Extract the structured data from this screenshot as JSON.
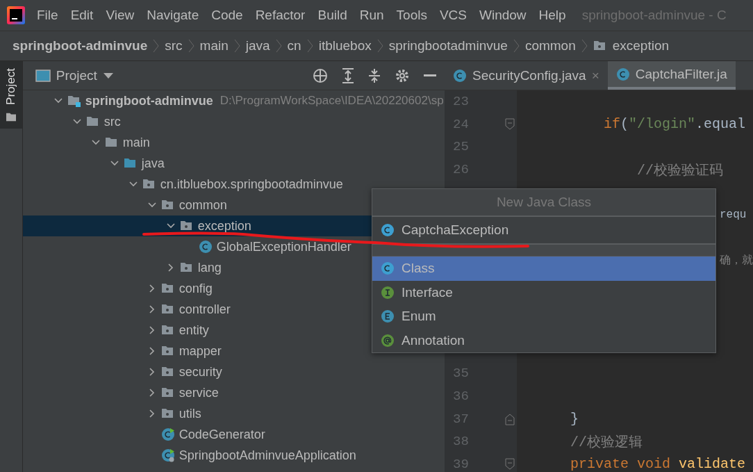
{
  "menu": {
    "items": [
      "File",
      "Edit",
      "View",
      "Navigate",
      "Code",
      "Refactor",
      "Build",
      "Run",
      "Tools",
      "VCS",
      "Window",
      "Help"
    ],
    "title": "springboot-adminvue - C"
  },
  "breadcrumbs": [
    {
      "label": "springboot-adminvue",
      "kind": "project"
    },
    {
      "label": "src",
      "kind": "plain"
    },
    {
      "label": "main",
      "kind": "plain"
    },
    {
      "label": "java",
      "kind": "plain"
    },
    {
      "label": "cn",
      "kind": "plain"
    },
    {
      "label": "itbluebox",
      "kind": "plain"
    },
    {
      "label": "springbootadminvue",
      "kind": "plain"
    },
    {
      "label": "common",
      "kind": "plain"
    },
    {
      "label": "exception",
      "kind": "folder"
    }
  ],
  "side_strip": {
    "label": "Project",
    "selected": true
  },
  "project_panel": {
    "title": "Project",
    "tree": [
      {
        "label": "springboot-adminvue",
        "path": "D:\\ProgramWorkSpace\\IDEA\\20220602\\sp",
        "kind": "module",
        "expanded": true,
        "selected": false,
        "children": [
          {
            "label": "src",
            "kind": "folder",
            "expanded": true,
            "selected": false,
            "children": [
              {
                "label": "main",
                "kind": "folder",
                "expanded": true,
                "selected": false,
                "children": [
                  {
                    "label": "java",
                    "kind": "source",
                    "expanded": true,
                    "selected": false,
                    "children": [
                      {
                        "label": "cn.itbluebox.springbootadminvue",
                        "kind": "package",
                        "expanded": true,
                        "selected": false,
                        "children": [
                          {
                            "label": "common",
                            "kind": "package",
                            "expanded": true,
                            "selected": false,
                            "children": [
                              {
                                "label": "exception",
                                "kind": "package",
                                "expanded": true,
                                "selected": true,
                                "children": [
                                  {
                                    "label": "GlobalExceptionHandler",
                                    "kind": "class",
                                    "selected": false
                                  }
                                ]
                              },
                              {
                                "label": "lang",
                                "kind": "package",
                                "expanded": false,
                                "selected": false
                              }
                            ]
                          },
                          {
                            "label": "config",
                            "kind": "package",
                            "expanded": false,
                            "selected": false
                          },
                          {
                            "label": "controller",
                            "kind": "package",
                            "expanded": false,
                            "selected": false
                          },
                          {
                            "label": "entity",
                            "kind": "package",
                            "expanded": false,
                            "selected": false
                          },
                          {
                            "label": "mapper",
                            "kind": "package",
                            "expanded": false,
                            "selected": false
                          },
                          {
                            "label": "security",
                            "kind": "package",
                            "expanded": false,
                            "selected": false
                          },
                          {
                            "label": "service",
                            "kind": "package",
                            "expanded": false,
                            "selected": false
                          },
                          {
                            "label": "utils",
                            "kind": "package",
                            "expanded": false,
                            "selected": false
                          },
                          {
                            "label": "CodeGenerator",
                            "kind": "runnable",
                            "selected": false
                          },
                          {
                            "label": "SpringbootAdminvueApplication",
                            "kind": "app",
                            "selected": false
                          }
                        ]
                      }
                    ]
                  }
                ]
              }
            ]
          }
        ]
      }
    ]
  },
  "editor": {
    "tabs": [
      {
        "label": "SecurityConfig.java",
        "close": "×",
        "selected": false
      },
      {
        "label": "CaptchaFilter.ja",
        "selected": true
      }
    ],
    "lines": [
      {
        "kind": "code",
        "number": "23"
      },
      {
        "kind": "fold-start",
        "number": "24",
        "tokens": [
          {
            "kind": "keyword",
            "text": "    if"
          },
          {
            "kind": "plain",
            "text": "("
          },
          {
            "kind": "string",
            "text": "\"/login\""
          },
          {
            "kind": "plain",
            "text": ".equal"
          }
        ]
      },
      {
        "kind": "code",
        "number": "25"
      },
      {
        "kind": "code",
        "number": "26",
        "tokens": [
          {
            "kind": "comment",
            "text": "        //校验验证码"
          }
        ]
      },
      {
        "kind": "covered"
      },
      {
        "kind": "peek",
        "tokens": [
          {
            "kind": "plain",
            "text": "requ"
          }
        ]
      },
      {
        "kind": "covered"
      },
      {
        "kind": "peek",
        "tokens": [
          {
            "kind": "comment",
            "text": "确，就"
          }
        ]
      },
      {
        "kind": "covered"
      },
      {
        "kind": "covered"
      },
      {
        "kind": "covered"
      },
      {
        "kind": "covered"
      },
      {
        "kind": "code",
        "number": "35"
      },
      {
        "kind": "code",
        "number": "36"
      },
      {
        "kind": "fold-end",
        "number": "37",
        "tokens": [
          {
            "kind": "plain",
            "text": "}"
          }
        ]
      },
      {
        "kind": "code",
        "number": "38",
        "tokens": [
          {
            "kind": "comment",
            "text": "//校验逻辑"
          }
        ]
      },
      {
        "kind": "fold-start",
        "number": "39",
        "tokens": [
          {
            "kind": "keyword",
            "text": "private void "
          },
          {
            "kind": "method",
            "text": "validate"
          }
        ]
      }
    ]
  },
  "popup": {
    "title": "New Java Class",
    "input": {
      "value": "CaptchaException"
    },
    "options": [
      {
        "label": "Class",
        "kind": "class",
        "selected": true
      },
      {
        "label": "Interface",
        "kind": "interface",
        "selected": false
      },
      {
        "label": "Enum",
        "kind": "enum",
        "selected": false
      },
      {
        "label": "Annotation",
        "kind": "annotation",
        "selected": false
      }
    ]
  }
}
